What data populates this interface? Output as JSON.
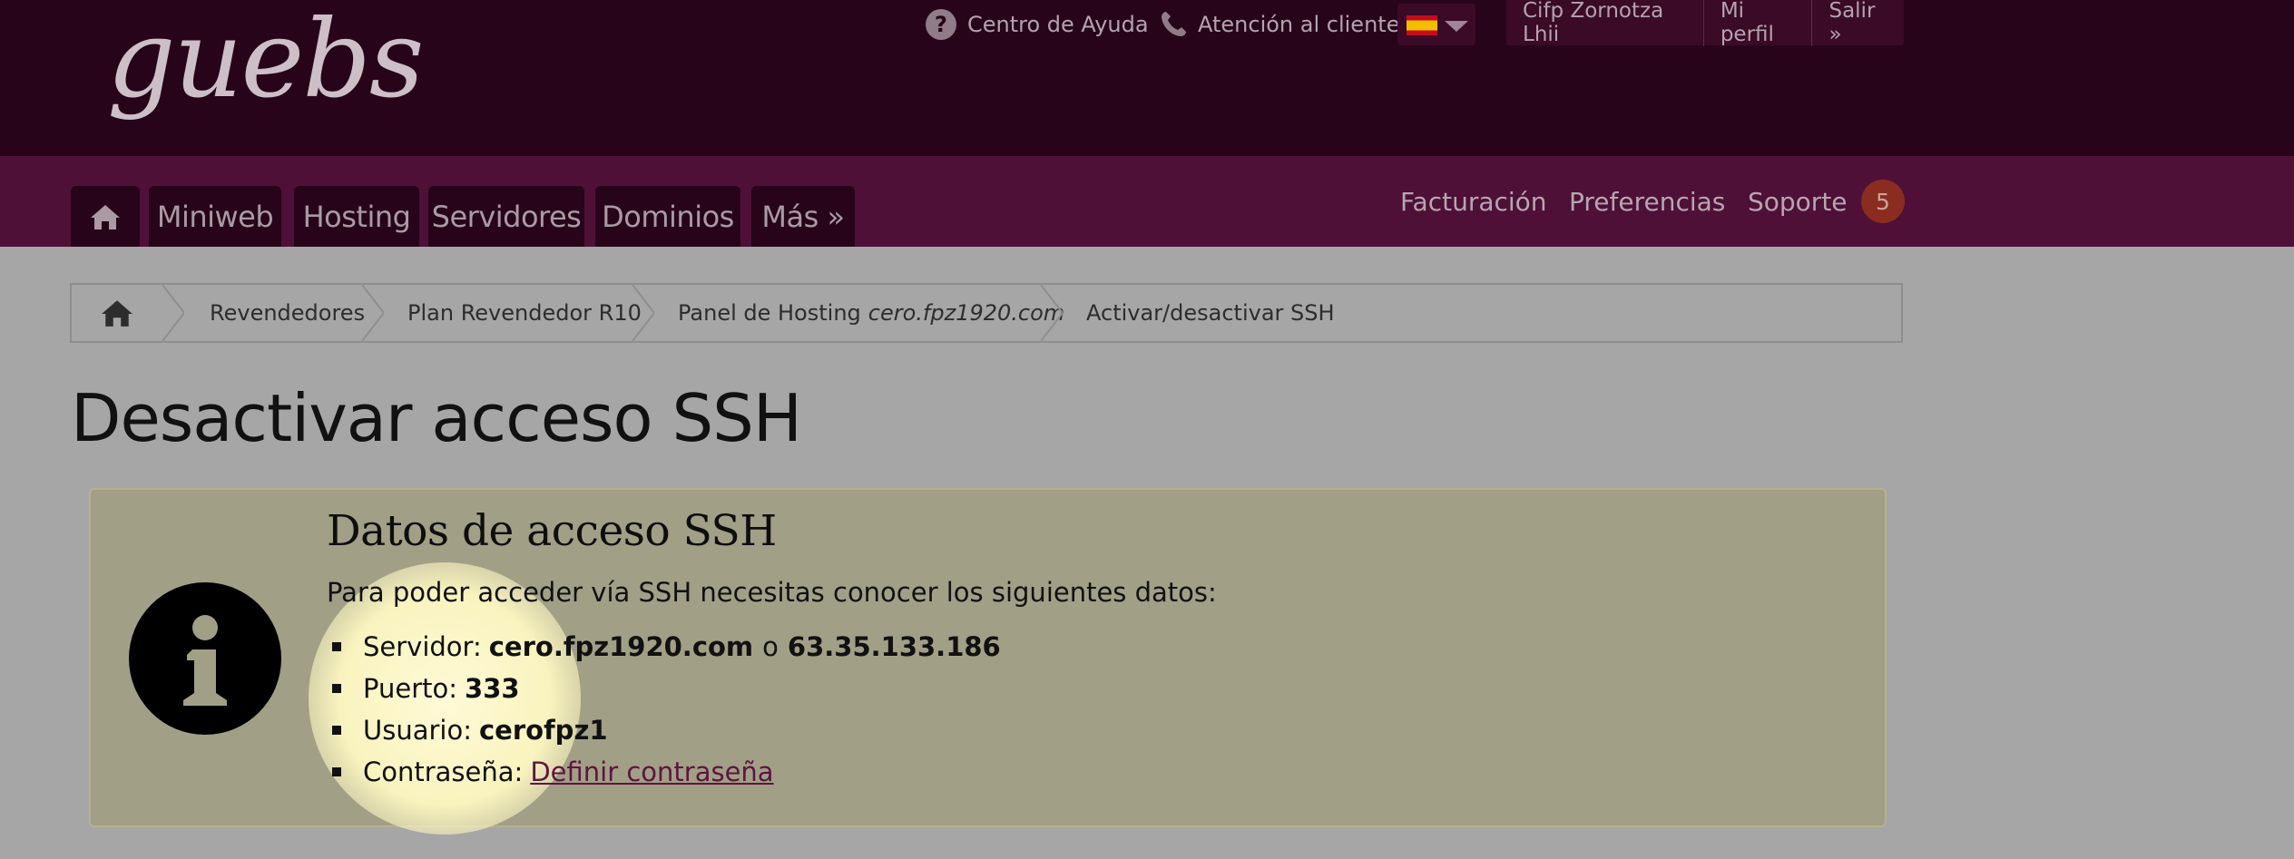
{
  "header": {
    "logo_text": "guebs",
    "help_label": "Centro de Ayuda",
    "support_label": "Atención al cliente",
    "language": "es",
    "user_name": "Cifp Zornotza Lhii",
    "profile_label": "Mi perfil",
    "logout_label": "Salir »"
  },
  "nav": {
    "tabs": [
      "Miniweb",
      "Hosting",
      "Servidores",
      "Dominios",
      "Más »"
    ],
    "right": [
      "Facturación",
      "Preferencias",
      "Soporte"
    ],
    "notifications": "5"
  },
  "breadcrumb": {
    "items": [
      "Revendedores",
      "Plan Revendedor R10",
      "Panel de Hosting",
      "Activar/desactivar SSH"
    ],
    "domain": "cero.fpz1920.com"
  },
  "page": {
    "title": "Desactivar acceso SSH"
  },
  "info": {
    "title": "Datos de acceso SSH",
    "intro": "Para poder acceder vía SSH necesitas conocer los siguientes datos:",
    "server_label": "Servidor:",
    "server_host": "cero.fpz1920.com",
    "or": "o",
    "server_ip": "63.35.133.186",
    "port_label": "Puerto:",
    "port": "333",
    "user_label": "Usuario:",
    "user": "cerofpz1",
    "password_label": "Contraseña:",
    "password_link": "Definir contraseña"
  },
  "colors": {
    "header_bg": "#27041a",
    "nav_bg": "#4e1037",
    "panel_bg": "#a19f86",
    "link": "#5c1540",
    "badge": "#8a2c1f"
  }
}
